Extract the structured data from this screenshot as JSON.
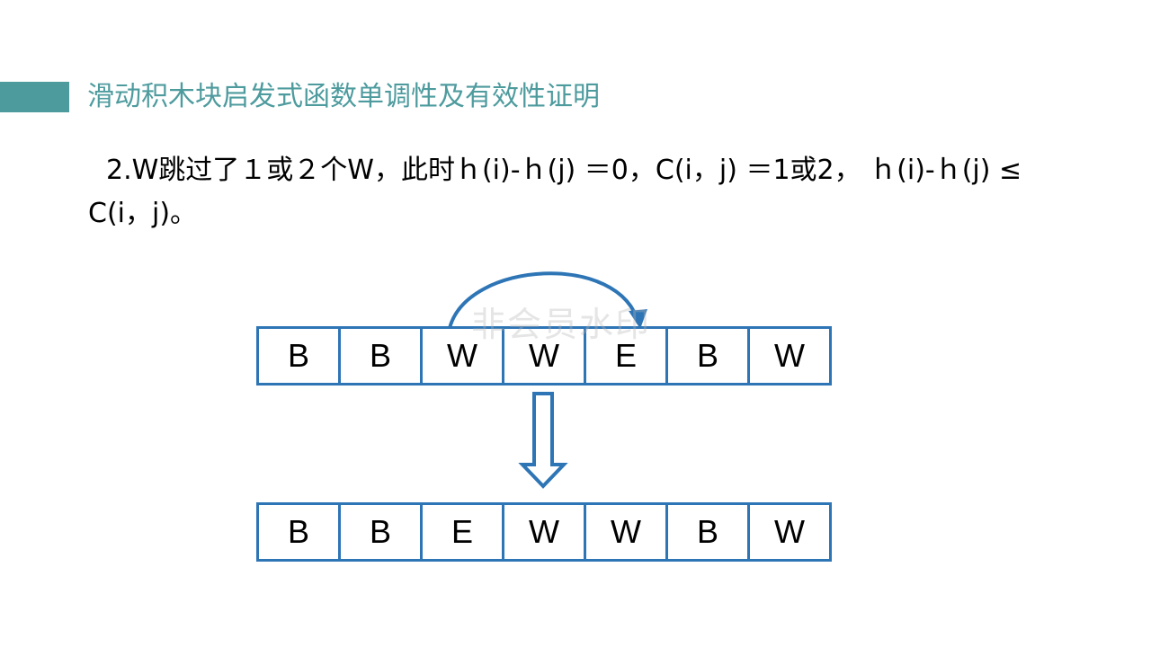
{
  "slide": {
    "title": "滑动积木块启发式函数单调性及有效性证明",
    "body": "2.W跳过了１或２个W，此时ｈ(i)-ｈ(j) ＝0，C(i，j) ＝1或2， ｈ(i)-ｈ(j) ≤ C(i，j)。",
    "watermark": "非会员水印"
  },
  "diagram": {
    "before": [
      "B",
      "B",
      "W",
      "W",
      "E",
      "B",
      "W"
    ],
    "after": [
      "B",
      "B",
      "E",
      "W",
      "W",
      "B",
      "W"
    ],
    "accent_color": "#2e75b6",
    "title_color": "#4e9b9e"
  }
}
